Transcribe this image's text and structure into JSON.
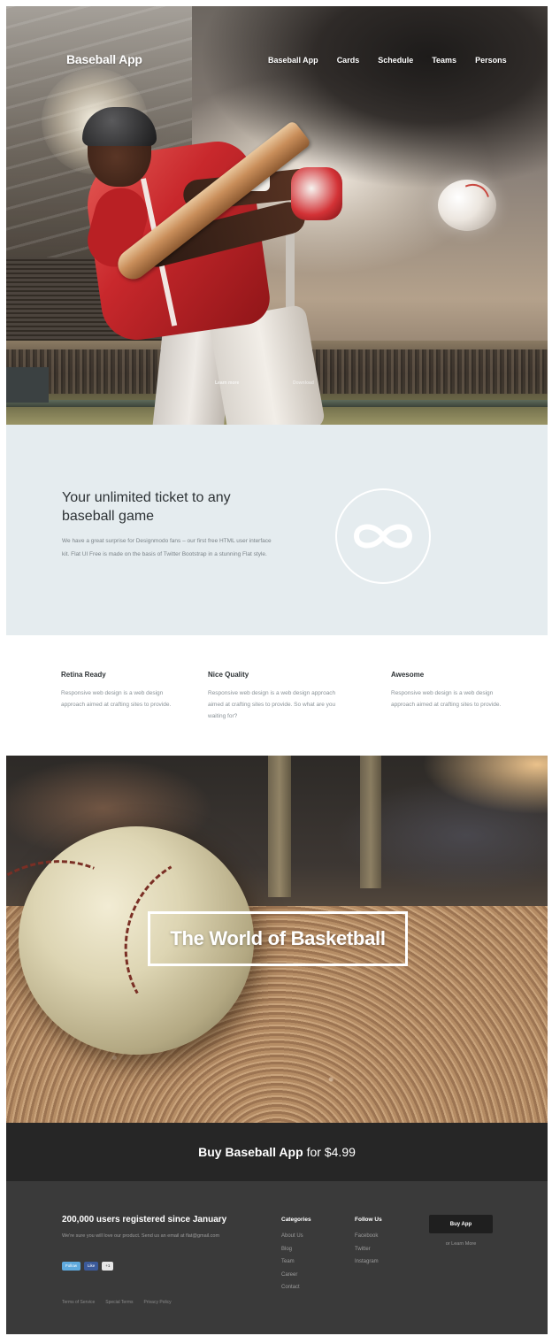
{
  "hero": {
    "brand": "Baseball App",
    "nav": [
      "Baseball App",
      "Cards",
      "Schedule",
      "Teams",
      "Persons"
    ],
    "caption_left": "Learn more",
    "caption_right": "Download"
  },
  "ticket": {
    "title": "Your unlimited ticket to any baseball game",
    "text": "We have a great surprise for Designmodo fans – our first free HTML user interface kit. Flat UI Free is made on the basis of Twitter Bootstrap in a stunning Flat style.",
    "icon": "infinity-icon"
  },
  "features": [
    {
      "title": "Retina Ready",
      "text": "Responsive web design is a web design approach aimed at crafting sites to provide."
    },
    {
      "title": "Nice Quality",
      "text": "Responsive web design is a web design approach aimed at crafting sites to provide. So what are you waiting for?"
    },
    {
      "title": "Awesome",
      "text": "Responsive web design is a web design approach aimed at crafting sites to provide."
    }
  ],
  "world": {
    "title": "The World of Basketball"
  },
  "buy": {
    "strong": "Buy Baseball App",
    "rest": "for $4.99"
  },
  "footer": {
    "title": "200,000 users registered since January",
    "desc": "We're sure you will love our product. Send us an email at flat@gmail.com",
    "badges": [
      "Follow",
      "Like",
      "+1"
    ],
    "legal": [
      "Terms of Service",
      "Special Terms",
      "Privacy Policy"
    ],
    "categories": {
      "heading": "Categories",
      "items": [
        "About Us",
        "Blog",
        "Team",
        "Career",
        "Contact"
      ]
    },
    "follow": {
      "heading": "Follow Us",
      "items": [
        "Facebook",
        "Twitter",
        "Instagram"
      ]
    },
    "buy_button": "Buy App",
    "learn_more": "or Learn More"
  },
  "colors": {
    "ticket_bg": "#e5ecef",
    "buybar_bg": "#262626",
    "footer_bg": "#3a3a3a"
  }
}
